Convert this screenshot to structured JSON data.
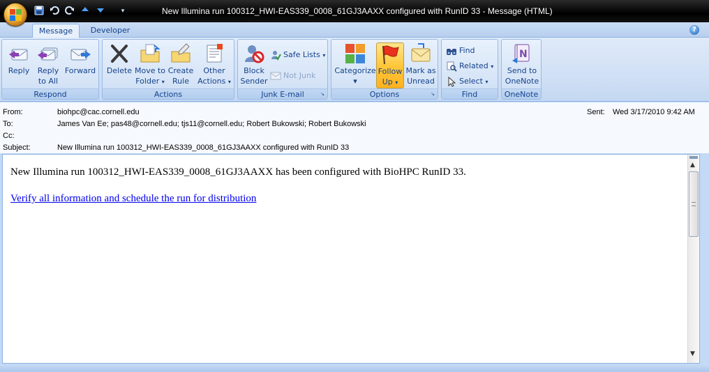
{
  "window": {
    "title": "New Illumina run 100312_HWI-EAS339_0008_61GJ3AAXX configured with RunID 33 - Message (HTML)"
  },
  "tabs": [
    {
      "label": "Message",
      "active": true
    },
    {
      "label": "Developer",
      "active": false
    }
  ],
  "ribbon": {
    "respond": {
      "label": "Respond",
      "reply": [
        "Reply",
        ""
      ],
      "reply_all": [
        "Reply",
        "to All"
      ],
      "forward": [
        "Forward",
        ""
      ]
    },
    "actions": {
      "label": "Actions",
      "delete": [
        "Delete",
        ""
      ],
      "move_to_folder": [
        "Move to",
        "Folder"
      ],
      "create_rule": [
        "Create",
        "Rule"
      ],
      "other_actions": [
        "Other",
        "Actions"
      ]
    },
    "junk": {
      "label": "Junk E-mail",
      "block_sender": [
        "Block",
        "Sender"
      ],
      "safe_lists": "Safe Lists",
      "not_junk": "Not Junk"
    },
    "options": {
      "label": "Options",
      "categorize": [
        "Categorize",
        ""
      ],
      "follow_up": [
        "Follow",
        "Up"
      ],
      "mark_as_unread": [
        "Mark as",
        "Unread"
      ]
    },
    "find": {
      "label": "Find",
      "find": "Find",
      "related": "Related",
      "select": "Select"
    },
    "onenote": {
      "label": "OneNote",
      "send_to_onenote": [
        "Send to",
        "OneNote"
      ]
    }
  },
  "message": {
    "from_label": "From:",
    "from": "biohpc@cac.cornell.edu",
    "to_label": "To:",
    "to": "James Van Ee; pas48@cornell.edu; tjs11@cornell.edu; Robert Bukowski; Robert Bukowski",
    "cc_label": "Cc:",
    "cc": "",
    "subject_label": "Subject:",
    "subject": "New Illumina run 100312_HWI-EAS339_0008_61GJ3AAXX configured with RunID 33",
    "sent_label": "Sent:",
    "sent": "Wed 3/17/2010 9:42 AM",
    "body_text": "New Illumina run 100312_HWI-EAS339_0008_61GJ3AAXX has been configured with BioHPC RunID 33.",
    "body_link": "Verify all information and schedule the run for distribution"
  },
  "colors": {
    "accent": "#15428b",
    "ribbon": "#d0e0f5",
    "link": "#0000ee",
    "highlight": "#ffc73b"
  },
  "icons": [
    "office-button-icon",
    "save-icon",
    "undo-icon",
    "redo-icon",
    "previous-item-icon",
    "next-item-icon",
    "customize-qat-icon",
    "help-icon",
    "reply-icon",
    "reply-all-icon",
    "forward-icon",
    "delete-icon",
    "move-to-folder-icon",
    "create-rule-icon",
    "other-actions-icon",
    "block-sender-icon",
    "safe-lists-icon",
    "not-junk-icon",
    "categorize-icon",
    "follow-up-flag-icon",
    "mark-unread-icon",
    "find-icon",
    "related-icon",
    "select-icon",
    "send-to-onenote-icon"
  ]
}
